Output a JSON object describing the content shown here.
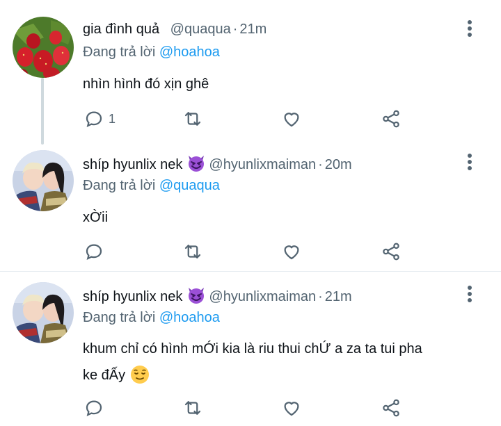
{
  "replying_prefix": "Đang trả lời",
  "tweets": [
    {
      "name": "gia đình quả",
      "handle": "@quaqua",
      "separator": "·",
      "time": "21m",
      "reply_to": "@hoahoa",
      "text_lines": [
        "nhìn hình đó xịn ghê"
      ],
      "reply_count": "1",
      "avatar": "strawberries-avatar"
    },
    {
      "name": "shíp hyunlix nek",
      "name_emoji": "smiling-devil-emoji",
      "handle": "@hyunlixmaiman",
      "separator": "·",
      "time": "20m",
      "reply_to": "@quaqua",
      "text_lines": [
        "xỜii"
      ],
      "reply_count": "",
      "avatar": "couple-photo-avatar"
    },
    {
      "name": "shíp hyunlix nek",
      "name_emoji": "smiling-devil-emoji",
      "handle": "@hyunlixmaiman",
      "separator": "·",
      "time": "21m",
      "reply_to": "@hoahoa",
      "text_lines": [
        "khum chỉ có hình mỚi kia là riu thui chỨ a za ta tui pha",
        "ke đẤy"
      ],
      "text_emoji": "relieved-face-emoji",
      "reply_count": "",
      "avatar": "couple-photo-avatar"
    }
  ],
  "colors": {
    "link": "#1d9bf0",
    "muted": "#536471",
    "text": "#0f1419"
  },
  "action_icons": [
    "reply-icon",
    "retweet-icon",
    "like-icon",
    "share-icon"
  ]
}
